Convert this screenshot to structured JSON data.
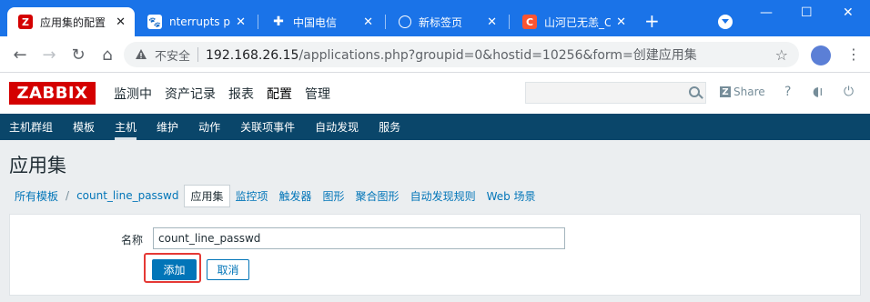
{
  "browser": {
    "tabs": [
      {
        "title": "应用集的配置",
        "icon": "zabbix-favicon",
        "active": true
      },
      {
        "title": "nterrupts pe",
        "icon": "baidu-paw-favicon",
        "active": false
      },
      {
        "title": "中国电信",
        "icon": "china-telecom-favicon",
        "active": false
      },
      {
        "title": "新标签页",
        "icon": "globe-favicon",
        "active": false
      },
      {
        "title": "山河已无恙_C",
        "icon": "csdn-favicon",
        "active": false
      }
    ],
    "tab_close": "✕",
    "new_tab": "+",
    "window_controls": {
      "minimize": "—",
      "maximize": "☐",
      "close": "✕"
    },
    "address": {
      "insecure_label": "不安全",
      "url_host": "192.168.26.15",
      "url_rest": "/applications.php?groupid=0&hostid=10256&form=创建应用集"
    }
  },
  "zabbix": {
    "logo": "ZABBIX",
    "top_nav": [
      "监测中",
      "资产记录",
      "报表",
      "配置",
      "管理"
    ],
    "top_nav_active": "配置",
    "share_label": "Share",
    "help_label": "?",
    "sub_nav": [
      "主机群组",
      "模板",
      "主机",
      "维护",
      "动作",
      "关联项事件",
      "自动发现",
      "服务"
    ],
    "sub_nav_active": "主机",
    "page_title": "应用集",
    "breadcrumbs": {
      "all_templates": "所有模板",
      "separator": "/",
      "template": "count_line_passwd",
      "tabs": [
        "应用集",
        "监控项",
        "触发器",
        "图形",
        "聚合图形",
        "自动发现规则",
        "Web 场景"
      ]
    },
    "form": {
      "name_label": "名称",
      "name_value": "count_line_passwd",
      "add_button": "添加",
      "cancel_button": "取消"
    }
  },
  "colors": {
    "chrome_blue": "#1a73e8",
    "zabbix_red": "#d40000",
    "subnav_bg": "#0a466a",
    "link_blue": "#0275b8",
    "highlight_red": "#e53935"
  }
}
